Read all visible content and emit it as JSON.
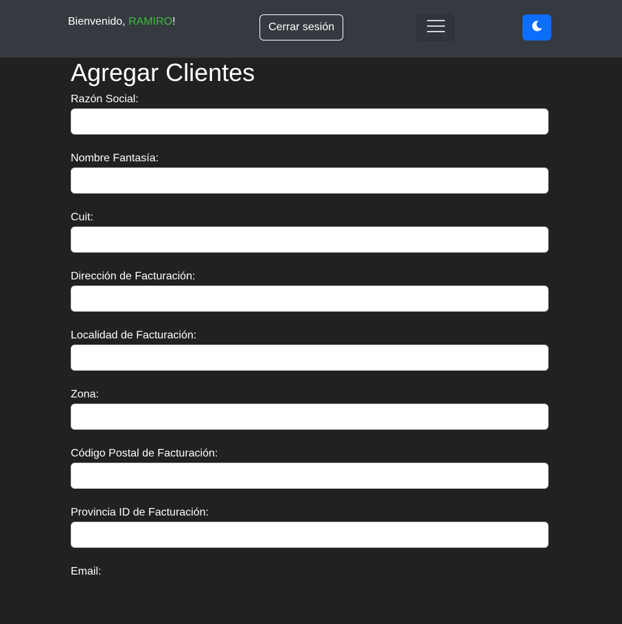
{
  "navbar": {
    "welcome_prefix": "Bienvenido, ",
    "username": "RAMIRO",
    "welcome_suffix": "!",
    "logout_label": "Cerrar sesión",
    "menu_icon": "hamburger-icon",
    "theme_icon": "moon-icon"
  },
  "page": {
    "title": "Agregar Clientes"
  },
  "form": {
    "fields": [
      {
        "label": "Razón Social:",
        "value": ""
      },
      {
        "label": "Nombre Fantasía:",
        "value": ""
      },
      {
        "label": "Cuit:",
        "value": ""
      },
      {
        "label": "Dirección de Facturación:",
        "value": ""
      },
      {
        "label": "Localidad de Facturación:",
        "value": ""
      },
      {
        "label": "Zona:",
        "value": ""
      },
      {
        "label": "Código Postal de Facturación:",
        "value": ""
      },
      {
        "label": "Provincia ID de Facturación:",
        "value": ""
      },
      {
        "label": "Email:",
        "value": ""
      }
    ]
  },
  "colors": {
    "background": "#212121",
    "navbar": "#343a40",
    "username": "#3fb93f",
    "primary_button": "#0d6efd"
  }
}
